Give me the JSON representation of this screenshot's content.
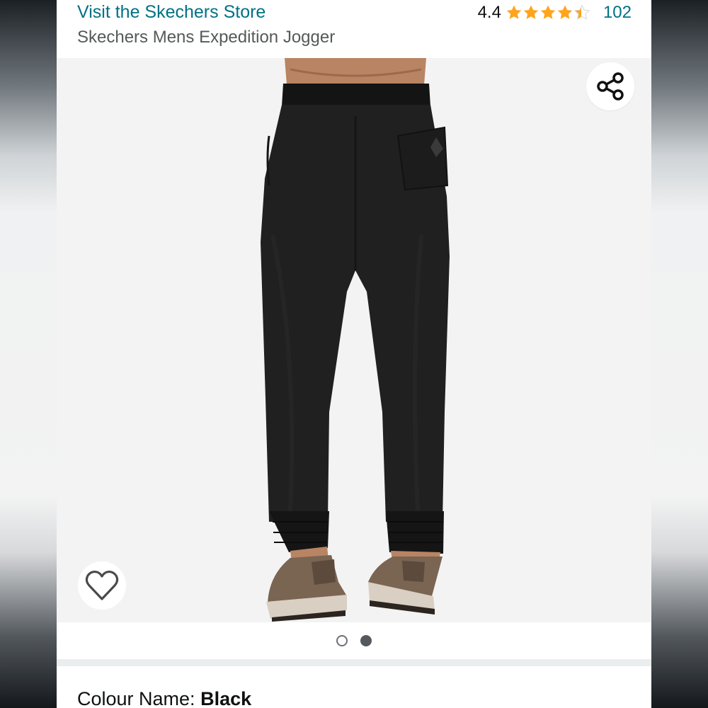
{
  "header": {
    "store_link": "Visit the Skechers Store",
    "product_title": "Skechers Mens Expedition Jogger",
    "rating": "4.4",
    "stars": 4.4,
    "review_count": "102"
  },
  "gallery": {
    "share_icon": "share-icon",
    "wishlist_icon": "heart-outline-icon",
    "image_count": 2,
    "current_index": 2
  },
  "colour": {
    "label": "Colour Name: ",
    "value": "Black"
  },
  "colors": {
    "link": "#007185",
    "star": "#FFA41C",
    "text_secondary": "#565959"
  }
}
